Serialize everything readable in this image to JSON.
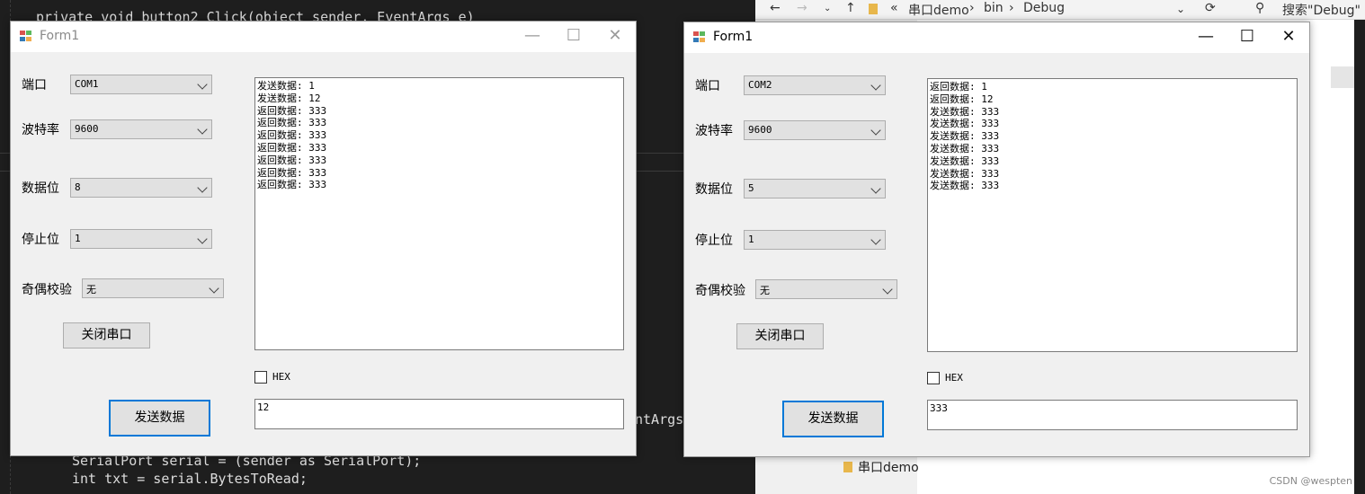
{
  "background": {
    "code_lines": [
      {
        "text": "private void button2_Click(object sender, EventArgs e)"
      },
      {
        "text": "ntArgs"
      },
      {
        "text": "SerialPort serial = (sender as SerialPort);"
      },
      {
        "text": "int txt = serial.BytesToRead;"
      }
    ],
    "explorer": {
      "path_prefix": "«",
      "path": [
        "串口demo",
        "bin",
        "Debug"
      ],
      "search_placeholder": "搜索\"Debug\"",
      "nav_item": "串口demo"
    }
  },
  "windows": [
    {
      "title": "Form1",
      "active": false,
      "fields": {
        "port_label": "端口",
        "port_value": "COM1",
        "baud_label": "波特率",
        "baud_value": "9600",
        "databits_label": "数据位",
        "databits_value": "8",
        "stopbits_label": "停止位",
        "stopbits_value": "1",
        "parity_label": "奇偶校验",
        "parity_value": "无"
      },
      "close_port_button": "关闭串口",
      "send_button": "发送数据",
      "log_lines": [
        "发送数据: 1",
        "发送数据: 12",
        "返回数据: 333",
        "返回数据: 333",
        "返回数据: 333",
        "返回数据: 333",
        "返回数据: 333",
        "返回数据: 333",
        "返回数据: 333"
      ],
      "hex_label": "HEX",
      "hex_checked": false,
      "send_input": "12"
    },
    {
      "title": "Form1",
      "active": true,
      "fields": {
        "port_label": "端口",
        "port_value": "COM2",
        "baud_label": "波特率",
        "baud_value": "9600",
        "databits_label": "数据位",
        "databits_value": "5",
        "stopbits_label": "停止位",
        "stopbits_value": "1",
        "parity_label": "奇偶校验",
        "parity_value": "无"
      },
      "close_port_button": "关闭串口",
      "send_button": "发送数据",
      "log_lines": [
        "返回数据: 1",
        "返回数据: 12",
        "发送数据: 333",
        "发送数据: 333",
        "发送数据: 333",
        "发送数据: 333",
        "发送数据: 333",
        "发送数据: 333",
        "发送数据: 333"
      ],
      "hex_label": "HEX",
      "hex_checked": false,
      "send_input": "333"
    }
  ],
  "window_controls": {
    "minimize": "—",
    "maximize": "☐",
    "close": "✕"
  },
  "watermark": "CSDN @wespten"
}
